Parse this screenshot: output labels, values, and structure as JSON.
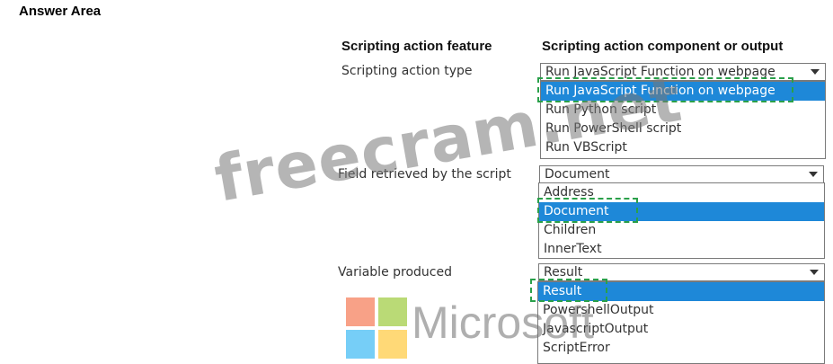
{
  "answer_area": "Answer Area",
  "headers": {
    "feature": "Scripting action feature",
    "component": "Scripting action component or output"
  },
  "rows": [
    {
      "label": "Scripting action type",
      "selected": "Run JavaScript Function on webpage",
      "options": [
        "Run JavaScript Function on webpage",
        "Run Python script",
        "Run PowerShell script",
        "Run VBScript"
      ],
      "highlighted_index": 0
    },
    {
      "label": "Field retrieved by the script",
      "selected": "Document",
      "options": [
        "Address",
        "Document",
        "Children",
        "InnerText"
      ],
      "highlighted_index": 1
    },
    {
      "label": "Variable produced",
      "selected": "Result",
      "options": [
        "Result",
        "PowershellOutput",
        "JavascriptOutput",
        "ScriptError"
      ],
      "highlighted_index": 0
    }
  ],
  "watermark": "freecram.net",
  "logo_text": "Microsoft",
  "colors": {
    "highlight": "#1e88d8",
    "dash": "#2aa04a",
    "logo_red": "#f35325",
    "logo_green": "#81bc06",
    "logo_blue": "#05a6f0",
    "logo_yellow": "#ffba08"
  }
}
